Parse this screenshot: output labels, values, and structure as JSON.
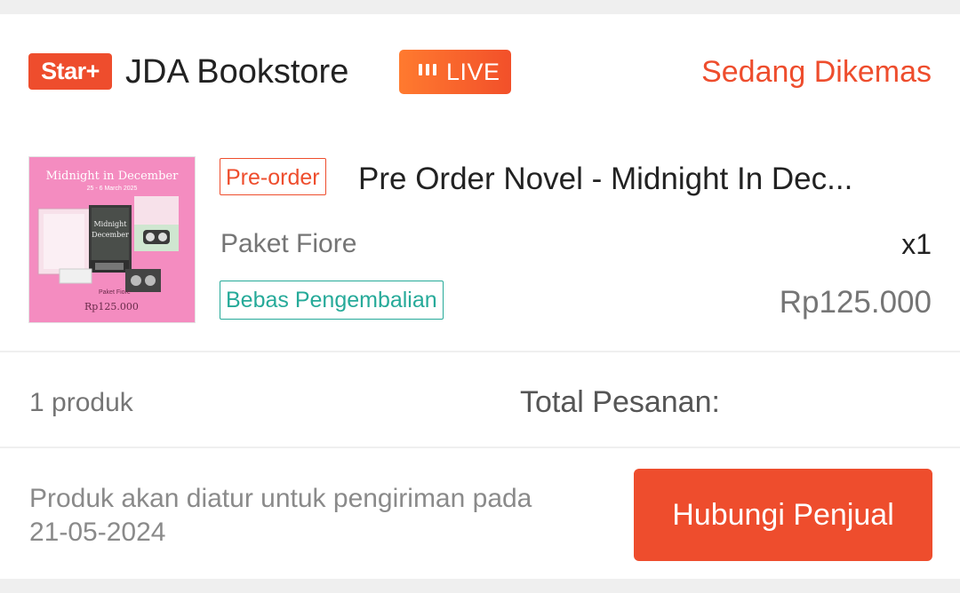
{
  "shop": {
    "badge": "Star+",
    "name": "JDA Bookstore",
    "live_label": "LIVE",
    "status": "Sedang Dikemas"
  },
  "product": {
    "image": {
      "title": "Midnight in December",
      "subtitle": "25 - 6 March 2025",
      "package_text": "Paket Fiore",
      "price_text": "Rp125.000"
    },
    "preorder_tag": "Pre-order",
    "name": "Pre Order Novel - Midnight In Dec...",
    "variation": "Paket Fiore",
    "quantity": "x1",
    "return_tag": "Bebas Pengembalian",
    "price": "Rp125.000"
  },
  "summary": {
    "count": "1 produk",
    "total_label": "Total Pesanan:"
  },
  "footer": {
    "ship_note_line1": "Produk akan diatur untuk pengiriman pada",
    "ship_note_line2": "21-05-2024",
    "contact_button": "Hubungi Penjual"
  },
  "colors": {
    "accent": "#ee4d2d",
    "green_tag": "#26aa99",
    "image_pink": "#f48cc0"
  },
  "icons": {
    "live": "live-bars-icon"
  }
}
